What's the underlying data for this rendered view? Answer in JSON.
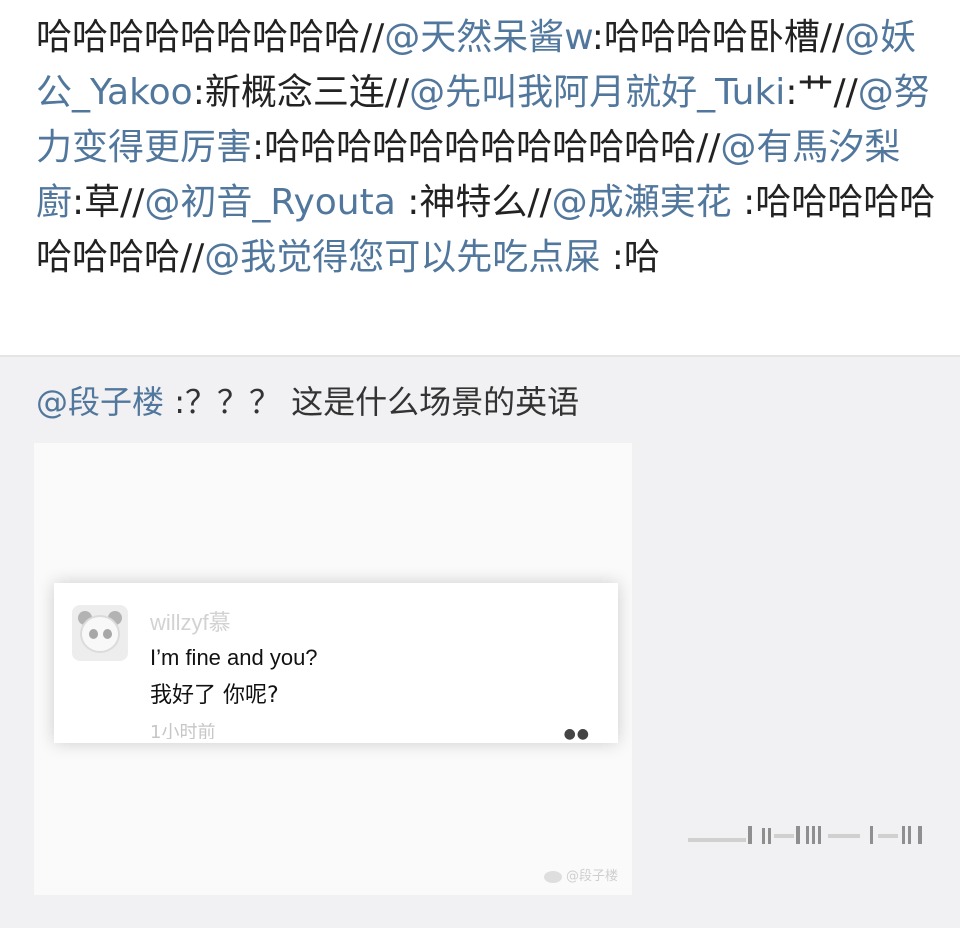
{
  "post": {
    "segments": [
      {
        "text": "哈哈哈哈哈哈哈哈哈//",
        "kind": "text"
      },
      {
        "text": "@天然呆酱w",
        "kind": "mention"
      },
      {
        "text": ":哈哈哈哈卧槽//",
        "kind": "text"
      },
      {
        "text": "@妖公_Yakoo",
        "kind": "mention"
      },
      {
        "text": ":新概念三连//",
        "kind": "text"
      },
      {
        "text": "@先叫我阿月就好_Tuki",
        "kind": "mention"
      },
      {
        "text": ":艹//",
        "kind": "text"
      },
      {
        "text": "@努力变得更厉害",
        "kind": "mention"
      },
      {
        "text": ":哈哈哈哈哈哈哈哈哈哈哈哈//",
        "kind": "text"
      },
      {
        "text": "@有馬汐梨廚",
        "kind": "mention"
      },
      {
        "text": ":草//",
        "kind": "text"
      },
      {
        "text": "@初音_Ryouta",
        "kind": "mention"
      },
      {
        "text": " :神特么//",
        "kind": "text"
      },
      {
        "text": "@成瀬実花",
        "kind": "mention"
      },
      {
        "text": " :哈哈哈哈哈哈哈哈哈//",
        "kind": "text"
      },
      {
        "text": "@我觉得您可以先吃点屎",
        "kind": "mention"
      },
      {
        "text": " :哈",
        "kind": "text"
      }
    ]
  },
  "repost": {
    "author": "@段子楼",
    "text": " :？？？ 这是什么场景的英语"
  },
  "image": {
    "username": "willzyf慕",
    "message_en": "I’m fine and you?",
    "message_cn": "我好了 你呢?",
    "time": "1小时前",
    "more_icon": "more-dots-icon",
    "watermark": "@段子楼",
    "avatar_icon": "panda-avatar-icon"
  },
  "colors": {
    "mention": "#51779d",
    "text": "#222222",
    "background": "#f1f1f3"
  }
}
